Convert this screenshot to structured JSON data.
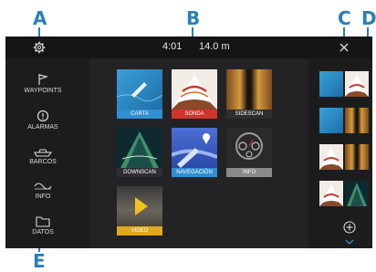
{
  "callouts": {
    "a": "A",
    "b": "B",
    "c": "C",
    "d": "D",
    "e": "E"
  },
  "status": {
    "time": "4:01",
    "depth": "14.0 m"
  },
  "sidebar": {
    "items": [
      {
        "label": "WAYPOINTS",
        "icon": "flag-icon"
      },
      {
        "label": "ALARMAS",
        "icon": "alarm-icon"
      },
      {
        "label": "BARCOS",
        "icon": "boat-icon"
      },
      {
        "label": "INFO",
        "icon": "wave-icon"
      },
      {
        "label": "DATOS",
        "icon": "folder-icon"
      }
    ]
  },
  "apps": [
    {
      "label": "CARTA",
      "label_color": "#2f8fd0"
    },
    {
      "label": "SONDA",
      "label_color": "#d0342c"
    },
    {
      "label": "SIDESCAN",
      "label_color": "#2e2e30"
    },
    {
      "label": "DOWNSCAN",
      "label_color": "#2e2e30"
    },
    {
      "label": "NAVEGACIÓN",
      "label_color": "#2f8fd0"
    },
    {
      "label": "INFO",
      "label_color": "#8a8a8c"
    },
    {
      "label": "VIDEO",
      "label_color": "#e0a81c"
    }
  ],
  "icons": {
    "settings": "gear-icon",
    "close": "close-icon",
    "add": "plus-circle-icon",
    "more": "chevron-down-icon"
  }
}
